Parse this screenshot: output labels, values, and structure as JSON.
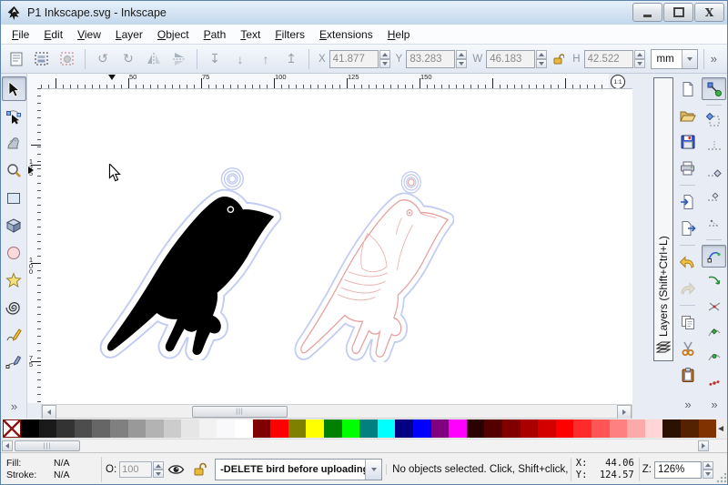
{
  "window": {
    "title": "P1 Inkscape.svg - Inkscape"
  },
  "menu": {
    "items": [
      "File",
      "Edit",
      "View",
      "Layer",
      "Object",
      "Path",
      "Text",
      "Filters",
      "Extensions",
      "Help"
    ]
  },
  "tool_controls": {
    "x_label": "X",
    "x_value": "41.877",
    "y_label": "Y",
    "y_value": "83.283",
    "w_label": "W",
    "w_value": "46.183",
    "h_label": "H",
    "h_value": "42.522",
    "units_value": "mm",
    "overflow": "»"
  },
  "toolbox": {
    "overflow": "»"
  },
  "rulers": {
    "horizontal_labels": [
      "50",
      "75",
      "100",
      "125",
      "150"
    ],
    "vertical_labels": [
      "125",
      "100",
      "75"
    ],
    "corner_badge": "1:1"
  },
  "layers_dock": {
    "tab_label": "Layers (Shift+Ctrl+L)"
  },
  "commands_bar": {
    "overflow": "»"
  },
  "snap_bar": {
    "overflow": "»"
  },
  "palette": {
    "swatches": [
      "#000000",
      "#1a1a1a",
      "#333333",
      "#4d4d4d",
      "#666666",
      "#808080",
      "#999999",
      "#b3b3b3",
      "#cccccc",
      "#e6e6e6",
      "#f2f2f2",
      "#f9f9fb",
      "#ffffff",
      "#800000",
      "#ff0000",
      "#808000",
      "#ffff00",
      "#008000",
      "#00ff00",
      "#008080",
      "#00ffff",
      "#000080",
      "#0000ff",
      "#800080",
      "#ff00ff",
      "#2b0000",
      "#550000",
      "#800000",
      "#aa0000",
      "#d40000",
      "#ff0000",
      "#ff2a2a",
      "#ff5555",
      "#ff8080",
      "#ffaaaa",
      "#ffd5d5",
      "#2b1100",
      "#552200",
      "#803300"
    ]
  },
  "statusbar": {
    "fill_label": "Fill:",
    "fill_value": "N/A",
    "stroke_label": "Stroke:",
    "stroke_value": "N/A",
    "opacity_label": "O:",
    "opacity_value": "100",
    "layer_current": "-DELETE bird before uploading",
    "message": "No objects selected. Click, Shift+click, or d",
    "x_label": "X:",
    "x_value": "44.06",
    "y_label": "Y:",
    "y_value": "124.57",
    "zoom_label": "Z:",
    "zoom_value": "126%"
  },
  "colors": {
    "titlebar": "#c3d8ec",
    "toolbar_bg": "#e9eef7",
    "cut_outline_blue": "#c3cdf3",
    "bird_fill": "#000000",
    "bird_trace_pink": "#e79f9f"
  },
  "icons": {
    "minimize": "–",
    "maximize": "box",
    "close": "X",
    "snap-toggle": "node-to-node-arrow",
    "undo": "curved-left-arrow",
    "redo": "curved-right-arrow",
    "cut": "scissors",
    "layer-visibility": "eye",
    "layer-lock": "open-padlock",
    "color-managed-display": "rainbow-triangle"
  }
}
